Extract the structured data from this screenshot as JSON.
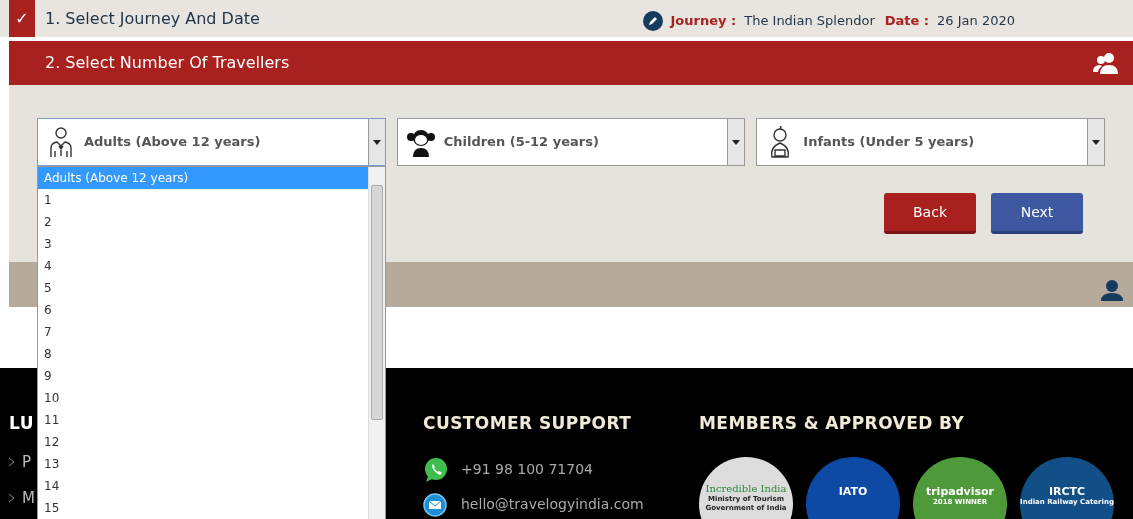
{
  "step1": {
    "check": "✓",
    "title": "1. Select Journey And Date",
    "journey_label": "Journey :",
    "journey": "The Indian Splendor",
    "date_label": "Date :",
    "date": "26 Jan 2020"
  },
  "step2": {
    "title": "2. Select Number Of Travellers"
  },
  "selects": [
    {
      "kind": "adult",
      "label": "Adults (Above 12 years)",
      "expanded": true
    },
    {
      "kind": "child",
      "label": "Children (5-12 years)",
      "expanded": false
    },
    {
      "kind": "infant",
      "label": "Infants (Under 5 years)",
      "expanded": false
    }
  ],
  "dropdown_options": [
    {
      "label": "Adults (Above 12 years)",
      "selected": true
    },
    {
      "label": "1",
      "selected": false
    },
    {
      "label": "2",
      "selected": false
    },
    {
      "label": "3",
      "selected": false
    },
    {
      "label": "4",
      "selected": false
    },
    {
      "label": "5",
      "selected": false
    },
    {
      "label": "6",
      "selected": false
    },
    {
      "label": "7",
      "selected": false
    },
    {
      "label": "8",
      "selected": false
    },
    {
      "label": "9",
      "selected": false
    },
    {
      "label": "10",
      "selected": false
    },
    {
      "label": "11",
      "selected": false
    },
    {
      "label": "12",
      "selected": false
    },
    {
      "label": "13",
      "selected": false
    },
    {
      "label": "14",
      "selected": false
    },
    {
      "label": "15",
      "selected": false
    }
  ],
  "buttons": [
    {
      "kind": "back",
      "label": "Back"
    },
    {
      "kind": "next",
      "label": "Next"
    }
  ],
  "footer": {
    "left_heading": "LU",
    "left_links": [
      "P",
      "M"
    ],
    "support_heading": "CUSTOMER SUPPORT",
    "phone": "+91 98 100 71704",
    "email": "hello@travelogyindia.com",
    "members_heading": "MEMBERS & APPROVED BY",
    "badges": [
      {
        "kind": "incredible",
        "lines": [
          "Incredible India",
          "Ministry of Tourism",
          "Government of India"
        ]
      },
      {
        "kind": "iato",
        "lines": [
          "IATO"
        ]
      },
      {
        "kind": "tripadvisor",
        "lines": [
          "tripadvisor",
          "2018 WINNER"
        ]
      },
      {
        "kind": "irctc",
        "lines": [
          "IRCTC",
          "Indian Railway Catering"
        ]
      }
    ]
  }
}
